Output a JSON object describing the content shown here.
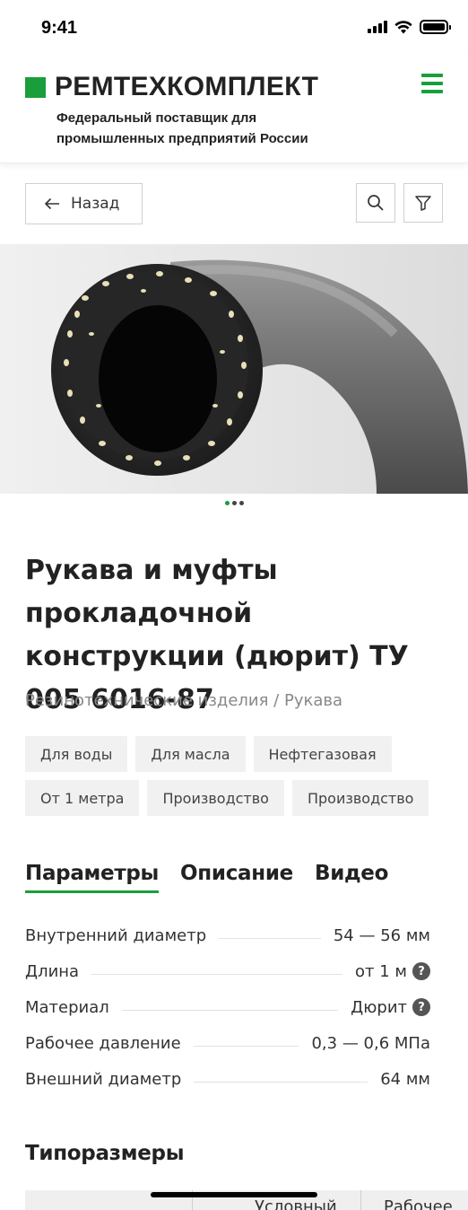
{
  "status_bar": {
    "time": "9:41"
  },
  "header": {
    "logo_text": "РЕМТЕХКОМПЛЕКТ",
    "tagline": "Федеральный поставщик для промышленных предприятий России",
    "brand_color": "#1a9e3b"
  },
  "toolbar": {
    "back_label": "Назад"
  },
  "gallery": {
    "total_slides": 3,
    "active_slide": 1
  },
  "product": {
    "title": "Рукава и муфты прокладочной конструкции (дюрит) ТУ 005 6016-87",
    "breadcrumb": "Резинотехнические изделия / Рукава",
    "tags": [
      "Для воды",
      "Для масла",
      "Нефтегазовая",
      "От 1 метра",
      "Производство",
      "Производство"
    ]
  },
  "tabs": [
    "Параметры",
    "Описание",
    "Видео"
  ],
  "params": [
    {
      "label": "Внутренний диаметр",
      "value": "54 — 56 мм",
      "help": false
    },
    {
      "label": "Длина",
      "value": "от 1 м",
      "help": true
    },
    {
      "label": "Материал",
      "value": "Дюрит",
      "help": true
    },
    {
      "label": "Рабочее давление",
      "value": "0,3 — 0,6 МПа",
      "help": false
    },
    {
      "label": "Внешний диаметр",
      "value": "64 мм",
      "help": false
    }
  ],
  "sizes": {
    "title": "Типоразмеры",
    "columns": [
      "",
      "Условный",
      "Рабочее"
    ]
  }
}
